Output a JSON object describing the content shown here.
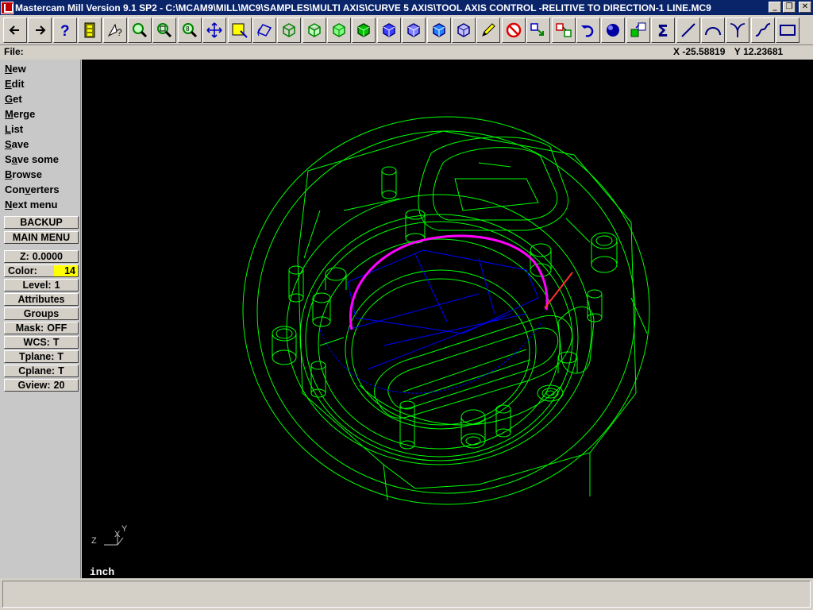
{
  "window": {
    "title": "Mastercam Mill Version 9.1 SP2 - C:\\MCAM9\\MILL\\MC9\\SAMPLES\\MULTI AXIS\\CURVE 5 AXIS\\TOOL AXIS CONTROL -RELITIVE TO DIRECTION-1 LINE.MC9",
    "minimize": "_",
    "restore": "❐",
    "close": "✕"
  },
  "toolbar": {
    "buttons": [
      "back-arrow-icon",
      "forward-arrow-icon",
      "help-icon",
      "settings-icon",
      "analyze-icon",
      "zoom-icon",
      "unzoom-icon",
      "zoom-fit-icon",
      "pan-icon",
      "gview-icon",
      "rotate-icon",
      "wire-cube-1-icon",
      "wire-cube-2-icon",
      "wire-cube-3-icon",
      "wire-cube-4-icon",
      "shaded-cube-1-icon",
      "shaded-cube-2-icon",
      "shaded-cube-3-icon",
      "shaded-cube-4-icon",
      "pencil-icon",
      "no-entry-icon",
      "tool-1-icon",
      "tool-2-icon",
      "undo-icon",
      "sphere-icon",
      "transform-icon",
      "sigma-icon",
      "line-icon",
      "arc-icon",
      "fillet-icon",
      "spline-icon",
      "rectangle-icon"
    ]
  },
  "status": {
    "file_label": "File:",
    "x_label": "X",
    "x_value": "-25.58819",
    "y_label": "Y",
    "y_value": "12.23681"
  },
  "menu": {
    "items": [
      {
        "pre": "",
        "key": "N",
        "post": "ew"
      },
      {
        "pre": "",
        "key": "E",
        "post": "dit"
      },
      {
        "pre": "",
        "key": "G",
        "post": "et"
      },
      {
        "pre": "",
        "key": "M",
        "post": "erge"
      },
      {
        "pre": "",
        "key": "L",
        "post": "ist"
      },
      {
        "pre": "",
        "key": "S",
        "post": "ave"
      },
      {
        "pre": "S",
        "key": "a",
        "post": "ve some"
      },
      {
        "pre": "",
        "key": "B",
        "post": "rowse"
      },
      {
        "pre": "Con",
        "key": "v",
        "post": "erters"
      },
      {
        "pre": "",
        "key": "N",
        "post": "ext menu"
      }
    ],
    "backup": "BACKUP",
    "main_menu": "MAIN MENU"
  },
  "params": {
    "z": {
      "label": "Z:",
      "value": "0.0000"
    },
    "color": {
      "label": "Color:",
      "value": "14",
      "swatch": "#ffff00"
    },
    "level": {
      "label": "Level:",
      "value": "1"
    },
    "attributes": "Attributes",
    "groups": "Groups",
    "mask": {
      "label": "Mask:",
      "value": "OFF"
    },
    "wcs": {
      "label": "WCS:",
      "value": "T"
    },
    "tplane": {
      "label": "Tplane:",
      "value": "T"
    },
    "cplane": {
      "label": "Cplane:",
      "value": "T"
    },
    "gview": {
      "label": "Gview:",
      "value": "20"
    }
  },
  "viewport": {
    "background": "#000000",
    "geometry_color": "#00ff00",
    "toolpath_color": "#ff00ff",
    "guide_color": "#0000ff",
    "units": "inch",
    "axis_x": "X",
    "axis_y": "Y",
    "axis_z": "Z"
  },
  "prompt": {
    "text": ""
  }
}
